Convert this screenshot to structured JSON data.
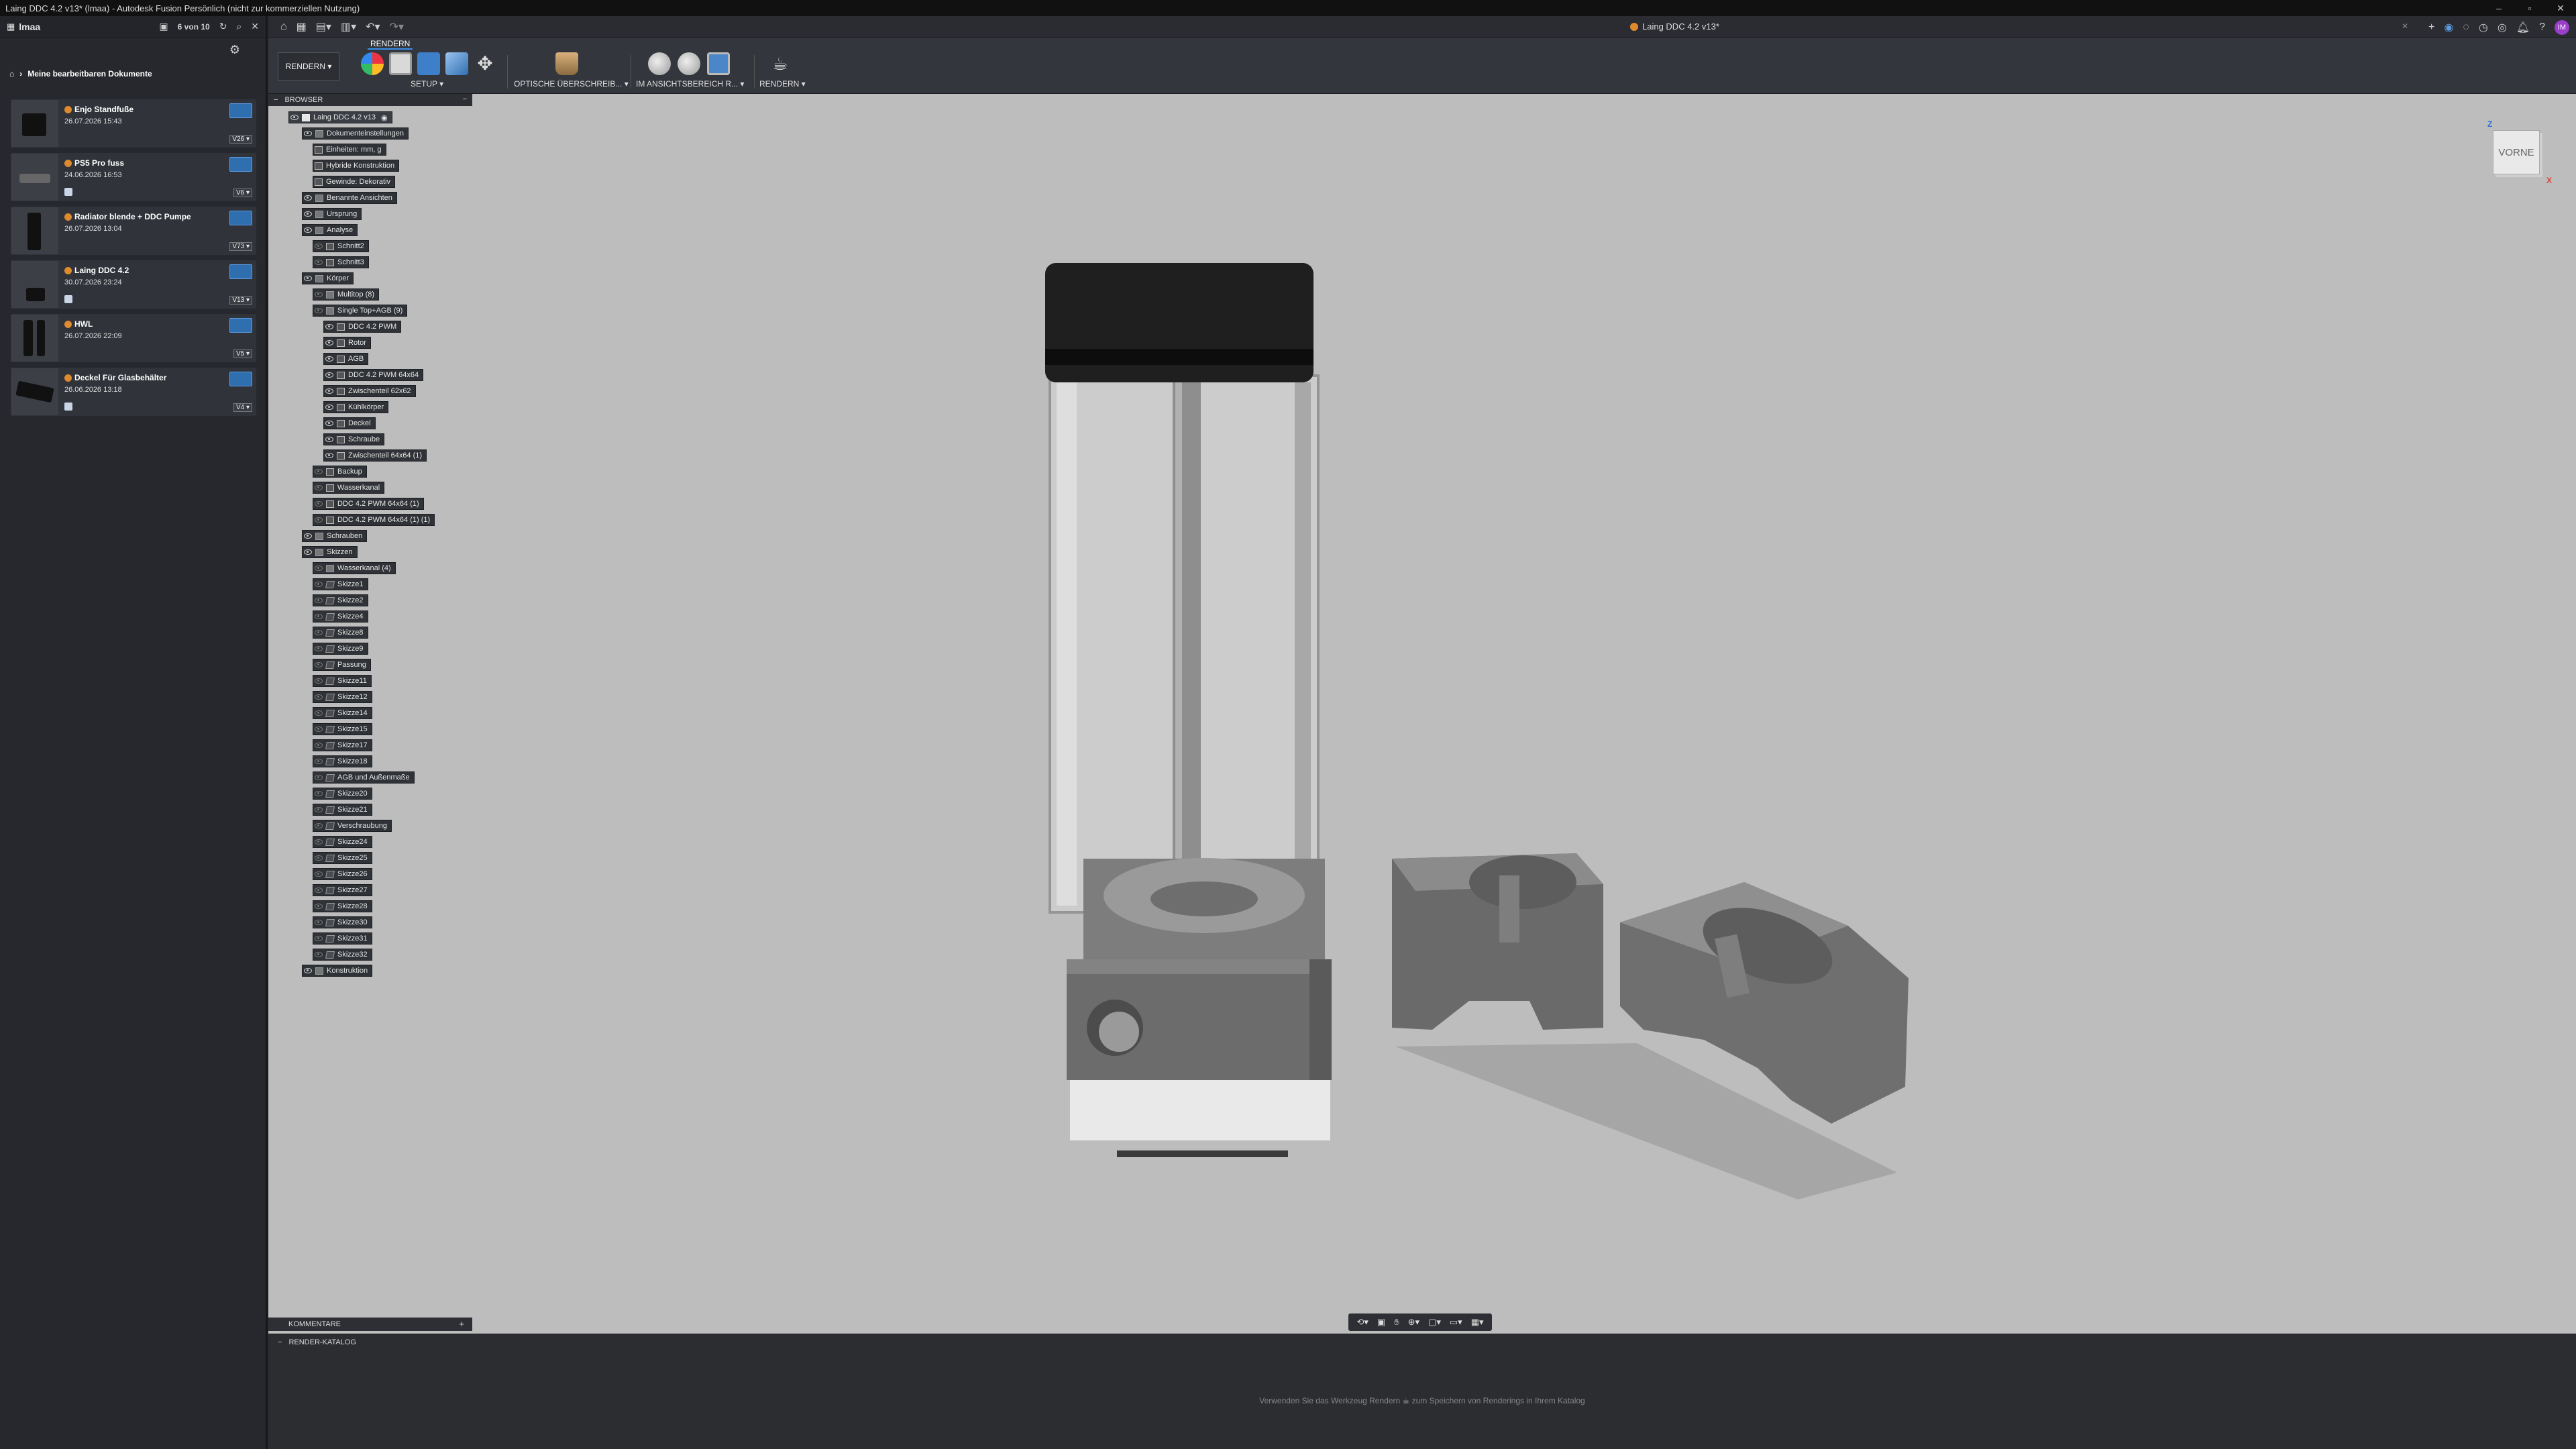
{
  "window": {
    "title": "Laing DDC 4.2 v13* (lmaa) - Autodesk Fusion Persönlich (nicht zur kommerziellen Nutzung)"
  },
  "left_panel": {
    "user": "lmaa",
    "counter": "6 von 10",
    "breadcrumb": "Meine bearbeitbaren Dokumente",
    "documents": [
      {
        "name": "Enjo Standfuße",
        "date": "26.07.2026 15:43",
        "version": "V26 ▾"
      },
      {
        "name": "PS5 Pro fuss",
        "date": "24.06.2026 16:53",
        "version": "V6 ▾"
      },
      {
        "name": "Radiator blende + DDC Pumpe",
        "date": "26.07.2026 13:04",
        "version": "V73 ▾"
      },
      {
        "name": "Laing DDC 4.2",
        "date": "30.07.2026 23:24",
        "version": "V13 ▾"
      },
      {
        "name": "HWL",
        "date": "26.07.2026 22:09",
        "version": "V5 ▾"
      },
      {
        "name": "Deckel Für Glasbehälter",
        "date": "26.06.2026 13:18",
        "version": "V4 ▾"
      }
    ]
  },
  "tab": {
    "title": "Laing DDC 4.2 v13*"
  },
  "toolbar": {
    "workspace": "RENDERN ▾",
    "tab": "RENDERN",
    "groups": [
      {
        "label": "SETUP ▾"
      },
      {
        "label": "OPTISCHE ÜBERSCHREIB... ▾"
      },
      {
        "label": "IM ANSICHTSBEREICH R... ▾"
      },
      {
        "label": "RENDERN ▾"
      }
    ]
  },
  "browser": {
    "title": "BROWSER",
    "nodes": [
      {
        "label": "Laing DDC 4.2 v13",
        "level": 0
      },
      {
        "label": "Dokumenteinstellungen",
        "level": 1
      },
      {
        "label": "Einheiten: mm, g",
        "level": 2
      },
      {
        "label": "Hybride Konstruktion",
        "level": 2
      },
      {
        "label": "Gewinde: Dekorativ",
        "level": 2
      },
      {
        "label": "Benannte Ansichten",
        "level": 1
      },
      {
        "label": "Ursprung",
        "level": 1
      },
      {
        "label": "Analyse",
        "level": 1
      },
      {
        "label": "Schnitt2",
        "level": 2
      },
      {
        "label": "Schnitt3",
        "level": 2
      },
      {
        "label": "Körper",
        "level": 1
      },
      {
        "label": "Multitop (8)",
        "level": 2
      },
      {
        "label": "Single Top+AGB (9)",
        "level": 2
      },
      {
        "label": "DDC 4.2 PWM",
        "level": 3
      },
      {
        "label": "Rotor",
        "level": 3
      },
      {
        "label": "AGB",
        "level": 3
      },
      {
        "label": "DDC 4.2 PWM 64x64",
        "level": 3
      },
      {
        "label": "Zwischenteil 62x62",
        "level": 3
      },
      {
        "label": "Kühlkörper",
        "level": 3
      },
      {
        "label": "Deckel",
        "level": 3
      },
      {
        "label": "Schraube",
        "level": 3
      },
      {
        "label": "Zwischenteil 64x64 (1)",
        "level": 3
      },
      {
        "label": "Backup",
        "level": 2
      },
      {
        "label": "Wasserkanal",
        "level": 2
      },
      {
        "label": "DDC 4.2 PWM 64x64 (1)",
        "level": 2
      },
      {
        "label": "DDC 4.2 PWM 64x64 (1) (1)",
        "level": 2
      },
      {
        "label": "Schrauben",
        "level": 1
      },
      {
        "label": "Skizzen",
        "level": 1
      },
      {
        "label": "Wasserkanal (4)",
        "level": 2
      },
      {
        "label": "Skizze1",
        "level": 2
      },
      {
        "label": "Skizze2",
        "level": 2
      },
      {
        "label": "Skizze4",
        "level": 2
      },
      {
        "label": "Skizze8",
        "level": 2
      },
      {
        "label": "Skizze9",
        "level": 2
      },
      {
        "label": "Passung",
        "level": 2
      },
      {
        "label": "Skizze11",
        "level": 2
      },
      {
        "label": "Skizze12",
        "level": 2
      },
      {
        "label": "Skizze14",
        "level": 2
      },
      {
        "label": "Skizze15",
        "level": 2
      },
      {
        "label": "Skizze17",
        "level": 2
      },
      {
        "label": "Skizze18",
        "level": 2
      },
      {
        "label": "AGB und Außenmaße",
        "level": 2
      },
      {
        "label": "Skizze20",
        "level": 2
      },
      {
        "label": "Skizze21",
        "level": 2
      },
      {
        "label": "Verschraubung",
        "level": 2
      },
      {
        "label": "Skizze24",
        "level": 2
      },
      {
        "label": "Skizze25",
        "level": 2
      },
      {
        "label": "Skizze26",
        "level": 2
      },
      {
        "label": "Skizze27",
        "level": 2
      },
      {
        "label": "Skizze28",
        "level": 2
      },
      {
        "label": "Skizze30",
        "level": 2
      },
      {
        "label": "Skizze31",
        "level": 2
      },
      {
        "label": "Skizze32",
        "level": 2
      },
      {
        "label": "Konstruktion",
        "level": 1
      }
    ]
  },
  "viewcube": {
    "face": "VORNE",
    "z": "Z",
    "x": "X"
  },
  "comments": {
    "title": "KOMMENTARE"
  },
  "catalog": {
    "title": "RENDER-KATALOG",
    "message_pre": "Verwenden Sie das Werkzeug Rendern",
    "message_post": "zum Speichern von Renderings in Ihrem Katalog"
  }
}
